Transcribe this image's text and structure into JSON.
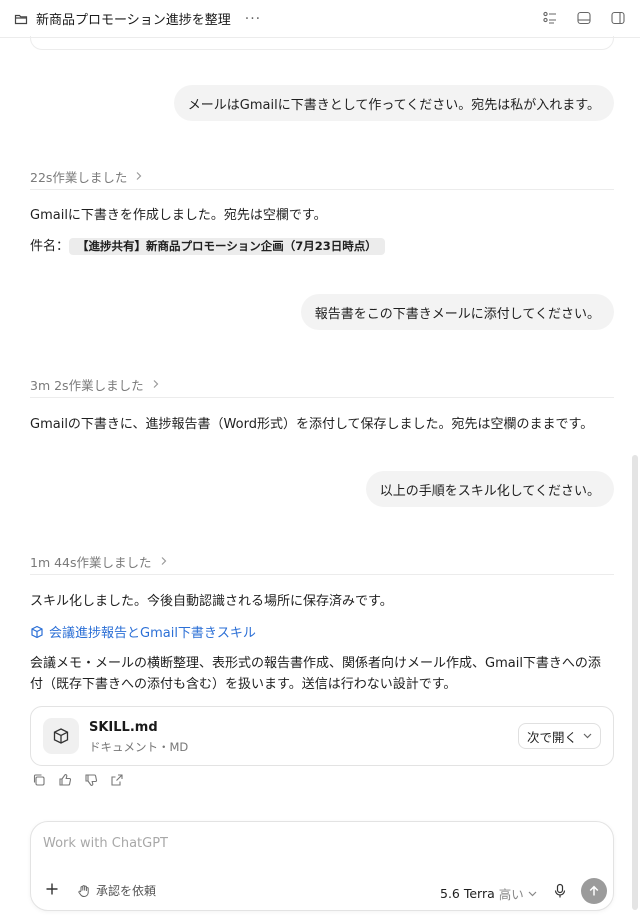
{
  "header": {
    "title": "新商品プロモーション進捗を整理",
    "more": "···"
  },
  "messages": {
    "user1": "メールはGmailに下書きとして作ってください。宛先は私が入れます。",
    "worked1": "22s作業しました",
    "reply1_line1": "Gmailに下書きを作成しました。宛先は空欄です。",
    "reply1_subject_label": "件名：",
    "reply1_subject": "【進捗共有】新商品プロモーション企画（7月23日時点）",
    "user2": "報告書をこの下書きメールに添付してください。",
    "worked2": "3m 2s作業しました",
    "reply2": "Gmailの下書きに、進捗報告書（Word形式）を添付して保存しました。宛先は空欄のままです。",
    "user3": "以上の手順をスキル化してください。",
    "worked3": "1m 44s作業しました",
    "reply3_line1": "スキル化しました。今後自動認識される場所に保存済みです。",
    "skill_link": "会議進捗報告とGmail下書きスキル",
    "reply3_desc_line1": "会議メモ・メールの横断整理、表形式の報告書作成、関係者向けメール作成、Gmail下書きへの添",
    "reply3_desc_line2": "付（既存下書きへの添付も含む）を扱います。送信は行わない設計です。"
  },
  "file": {
    "name": "SKILL.md",
    "type": "ドキュメント・MD",
    "open_label": "次で開く"
  },
  "composer": {
    "placeholder": "Work with ChatGPT",
    "approve_label": "承認を依頼",
    "model": "5.6 Terra",
    "level": "高い"
  },
  "colors": {
    "link": "#2b6fd6",
    "bubble": "#f3f3f3",
    "send": "#9b9b9b"
  }
}
